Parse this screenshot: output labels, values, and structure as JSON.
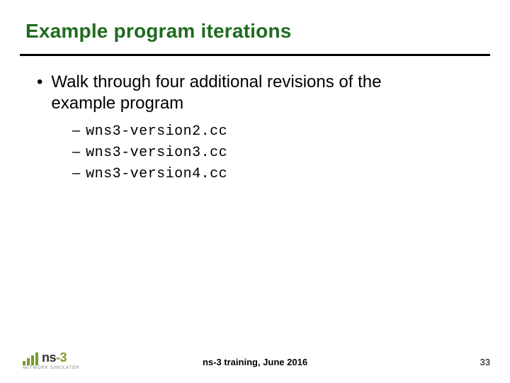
{
  "title": "Example program iterations",
  "bullet": {
    "text": "Walk through four additional revisions of the example program"
  },
  "sub_items": [
    "wns3-version2.cc",
    "wns3-version3.cc",
    "wns3-version4.cc"
  ],
  "footer": {
    "logo_main_prefix": "ns",
    "logo_main_suffix": "-3",
    "logo_sub": "NETWORK SIMULATOR",
    "center": "ns-3 training, June 2016",
    "page": "33"
  }
}
